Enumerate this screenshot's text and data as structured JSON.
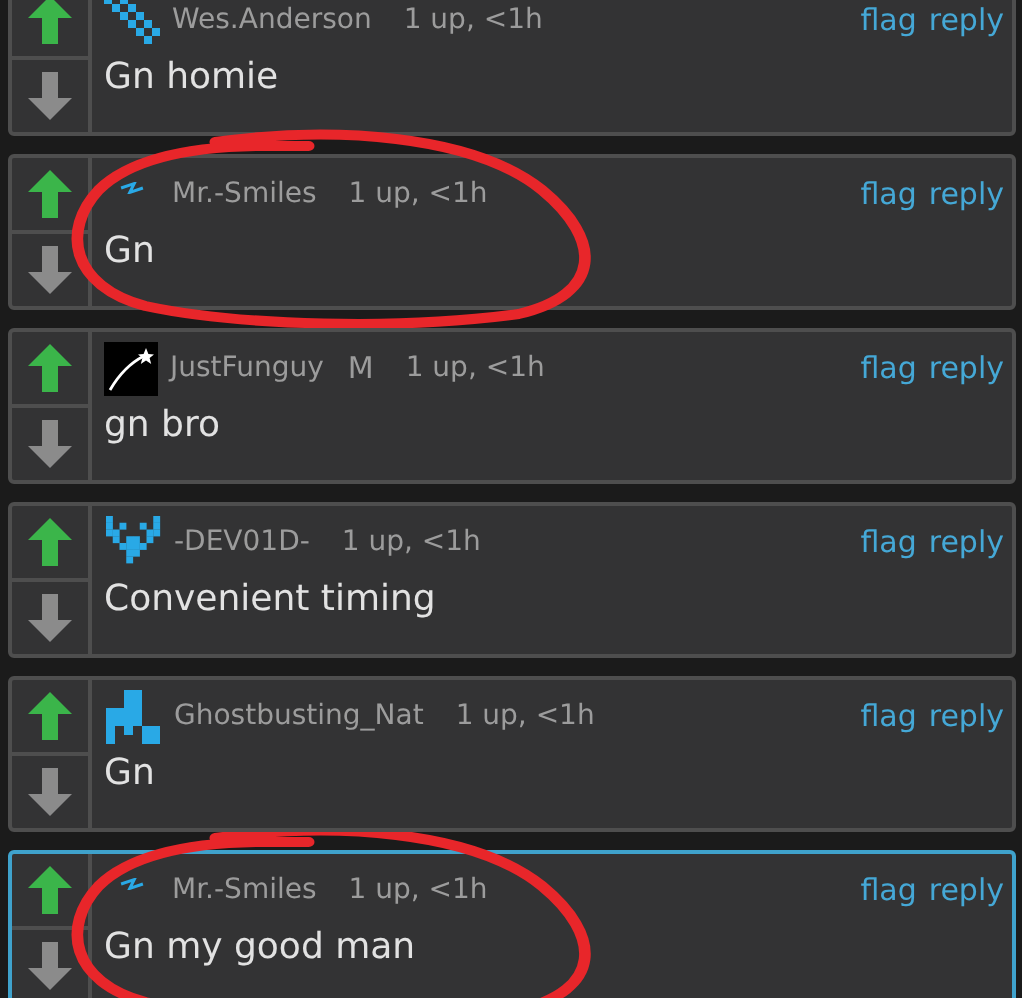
{
  "comments": [
    {
      "avatar": {
        "kind": "checker"
      },
      "user": "Wes.Anderson",
      "points": "1 up, <1h",
      "text": "Gn homie",
      "actions": [
        "flag",
        "reply"
      ],
      "selected": false,
      "circled": false
    },
    {
      "avatar": {
        "kind": "bolt"
      },
      "user": "Mr.-Smiles",
      "points": "1 up, <1h",
      "text": "Gn",
      "actions": [
        "flag",
        "reply"
      ],
      "selected": false,
      "circled": true
    },
    {
      "avatar": {
        "kind": "star"
      },
      "user": "JustFunguy",
      "badge": "M",
      "points": "1 up, <1h",
      "text": "gn bro",
      "actions": [
        "flag",
        "reply"
      ],
      "selected": false,
      "circled": false
    },
    {
      "avatar": {
        "kind": "glyph"
      },
      "user": "-DEV01D-",
      "points": "1 up, <1h",
      "text": "Convenient timing",
      "actions": [
        "flag",
        "reply"
      ],
      "selected": false,
      "circled": false
    },
    {
      "avatar": {
        "kind": "blocks"
      },
      "user": "Ghostbusting_Nat",
      "points": "1 up, <1h",
      "text": "Gn",
      "actions": [
        "flag",
        "reply"
      ],
      "selected": false,
      "circled": false
    },
    {
      "avatar": {
        "kind": "bolt"
      },
      "user": "Mr.-Smiles",
      "points": "1 up, <1h",
      "text": "Gn my good man",
      "actions": [
        "flag",
        "reply"
      ],
      "selected": true,
      "circled": true
    }
  ]
}
